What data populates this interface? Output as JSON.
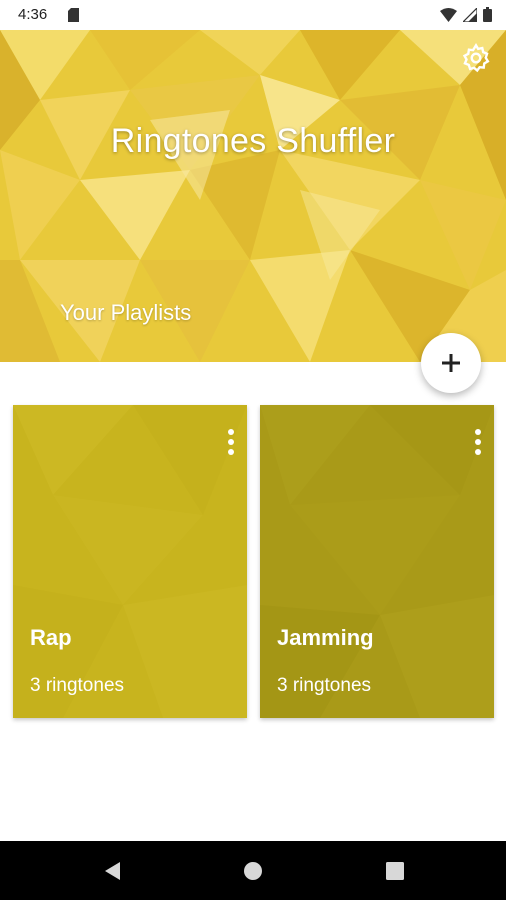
{
  "status_bar": {
    "time": "4:36",
    "icons": [
      "sd-card-icon",
      "wifi-icon",
      "cell-signal-icon",
      "battery-icon"
    ]
  },
  "header": {
    "title": "Ringtones Shuffler",
    "section_title": "Your Playlists",
    "settings_icon": "gear-icon",
    "background_color": "#E8C93A"
  },
  "fab": {
    "icon": "plus-icon"
  },
  "playlists": [
    {
      "name": "Rap",
      "count_label": "3 ringtones",
      "color": "#C8B41E",
      "menu_icon": "more-vert-icon"
    },
    {
      "name": "Jamming",
      "count_label": "3 ringtones",
      "color": "#A99A18",
      "menu_icon": "more-vert-icon"
    }
  ],
  "nav_bar": {
    "buttons": [
      "back-icon",
      "home-icon",
      "recents-icon"
    ]
  }
}
